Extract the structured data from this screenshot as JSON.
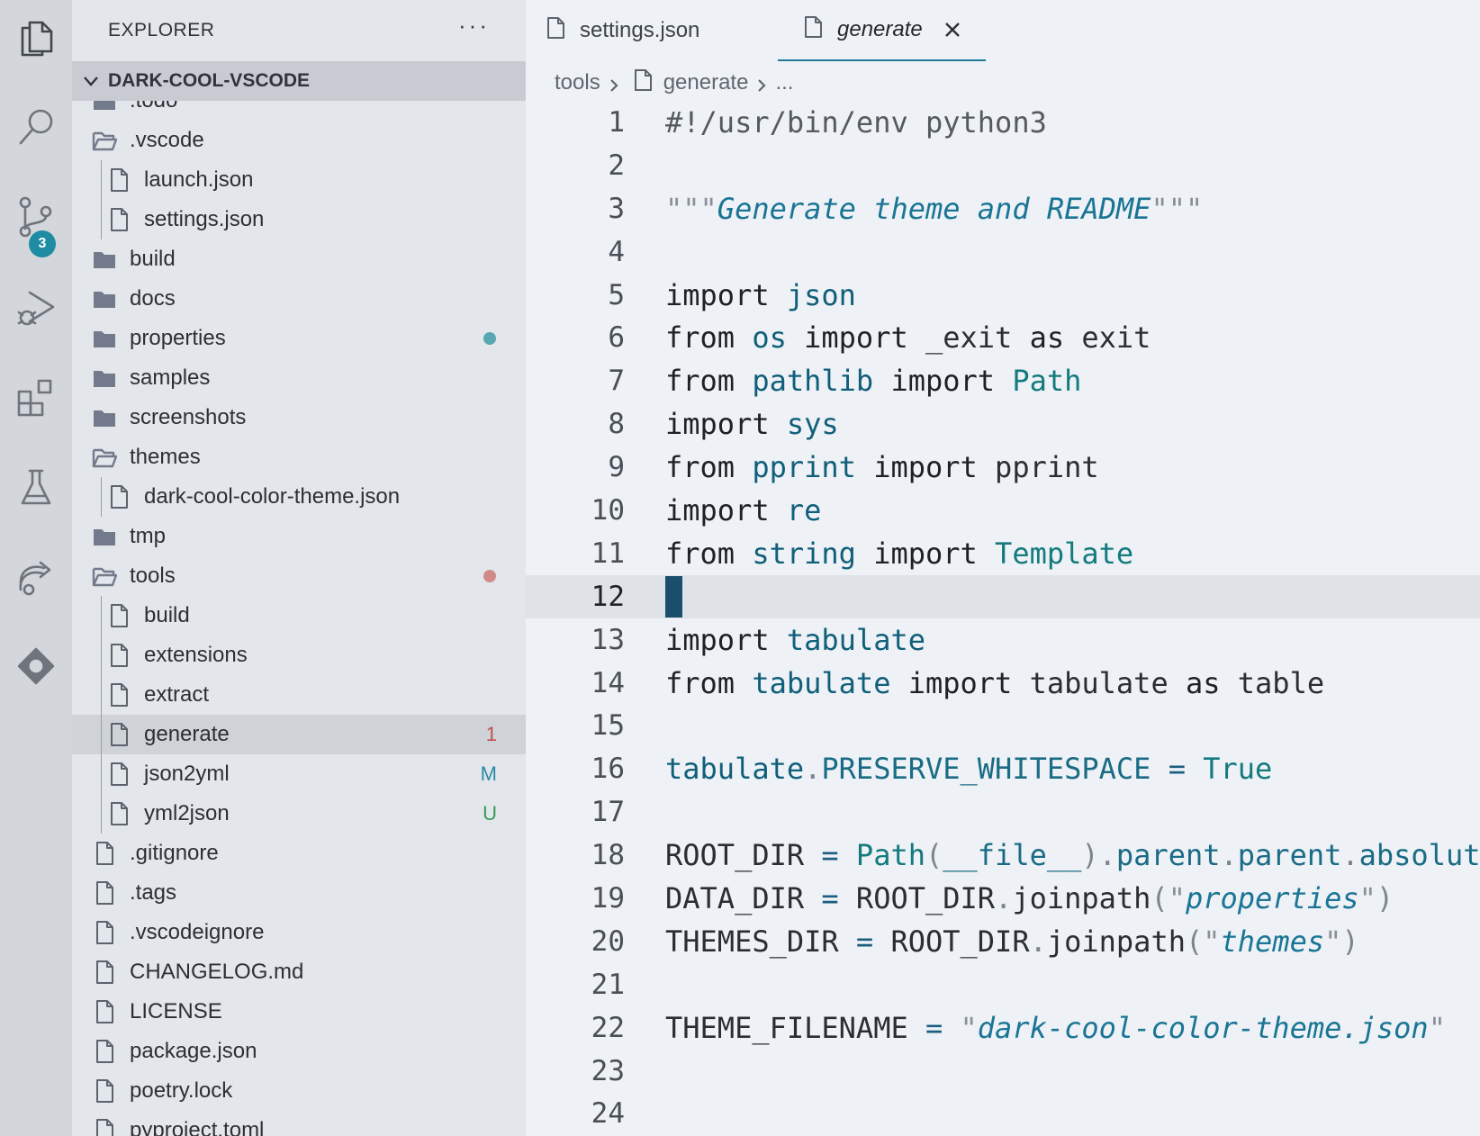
{
  "activity_bar": {
    "items": [
      "files-icon",
      "search-icon",
      "source-control-icon",
      "run-debug-icon",
      "extensions-icon",
      "testing-icon",
      "remote-icon",
      "gitlens-icon"
    ],
    "scm_badge": "3"
  },
  "explorer": {
    "title": "EXPLORER",
    "more": "···",
    "project": "DARK-COOL-VSCODE",
    "tree": [
      {
        "label": ".todo",
        "type": "folder",
        "depth": 0
      },
      {
        "label": ".vscode",
        "type": "folder-open",
        "depth": 0
      },
      {
        "label": "launch.json",
        "type": "file",
        "depth": 1
      },
      {
        "label": "settings.json",
        "type": "file",
        "depth": 1
      },
      {
        "label": "build",
        "type": "folder",
        "depth": 0
      },
      {
        "label": "docs",
        "type": "folder",
        "depth": 0
      },
      {
        "label": "properties",
        "type": "folder",
        "depth": 0,
        "dot": "#5aa7b3"
      },
      {
        "label": "samples",
        "type": "folder",
        "depth": 0
      },
      {
        "label": "screenshots",
        "type": "folder",
        "depth": 0
      },
      {
        "label": "themes",
        "type": "folder-open",
        "depth": 0
      },
      {
        "label": "dark-cool-color-theme.json",
        "type": "file",
        "depth": 1
      },
      {
        "label": "tmp",
        "type": "folder",
        "depth": 0
      },
      {
        "label": "tools",
        "type": "folder-open",
        "depth": 0,
        "dot": "#d08a8a"
      },
      {
        "label": "build",
        "type": "file",
        "depth": 1
      },
      {
        "label": "extensions",
        "type": "file",
        "depth": 1
      },
      {
        "label": "extract",
        "type": "file",
        "depth": 1
      },
      {
        "label": "generate",
        "type": "file",
        "depth": 1,
        "badge": "1",
        "badge_color": "#c0504d",
        "selected": true
      },
      {
        "label": "json2yml",
        "type": "file",
        "depth": 1,
        "badge": "M",
        "badge_color": "#2a8aa8"
      },
      {
        "label": "yml2json",
        "type": "file",
        "depth": 1,
        "badge": "U",
        "badge_color": "#3a9a5b"
      },
      {
        "label": ".gitignore",
        "type": "file",
        "depth": 0
      },
      {
        "label": ".tags",
        "type": "file",
        "depth": 0
      },
      {
        "label": ".vscodeignore",
        "type": "file",
        "depth": 0
      },
      {
        "label": "CHANGELOG.md",
        "type": "file",
        "depth": 0
      },
      {
        "label": "LICENSE",
        "type": "file",
        "depth": 0
      },
      {
        "label": "package.json",
        "type": "file",
        "depth": 0
      },
      {
        "label": "poetry.lock",
        "type": "file",
        "depth": 0
      },
      {
        "label": "pyproject.toml",
        "type": "file",
        "depth": 0
      }
    ]
  },
  "tabs": [
    {
      "label": "settings.json",
      "active": false
    },
    {
      "label": "generate",
      "active": true
    }
  ],
  "breadcrumb": {
    "folder": "tools",
    "file": "generate",
    "more": "..."
  },
  "editor": {
    "current_line": 12,
    "lines": [
      [
        [
          "comment",
          "#!/usr/bin/env python3"
        ]
      ],
      [],
      [
        [
          "q",
          "\"\"\""
        ],
        [
          "str",
          "Generate theme and README"
        ],
        [
          "q",
          "\"\"\""
        ]
      ],
      [],
      [
        [
          "kw",
          "import"
        ],
        [
          "txt",
          " "
        ],
        [
          "mod",
          "json"
        ]
      ],
      [
        [
          "kw",
          "from"
        ],
        [
          "txt",
          " "
        ],
        [
          "mod",
          "os"
        ],
        [
          "txt",
          " "
        ],
        [
          "kw",
          "import"
        ],
        [
          "txt",
          " _exit "
        ],
        [
          "kw",
          "as"
        ],
        [
          "txt",
          " exit"
        ]
      ],
      [
        [
          "kw",
          "from"
        ],
        [
          "txt",
          " "
        ],
        [
          "mod",
          "pathlib"
        ],
        [
          "txt",
          " "
        ],
        [
          "kw",
          "import"
        ],
        [
          "txt",
          " "
        ],
        [
          "cls",
          "Path"
        ]
      ],
      [
        [
          "kw",
          "import"
        ],
        [
          "txt",
          " "
        ],
        [
          "mod",
          "sys"
        ]
      ],
      [
        [
          "kw",
          "from"
        ],
        [
          "txt",
          " "
        ],
        [
          "mod",
          "pprint"
        ],
        [
          "txt",
          " "
        ],
        [
          "kw",
          "import"
        ],
        [
          "txt",
          " pprint"
        ]
      ],
      [
        [
          "kw",
          "import"
        ],
        [
          "txt",
          " "
        ],
        [
          "mod",
          "re"
        ]
      ],
      [
        [
          "kw",
          "from"
        ],
        [
          "txt",
          " "
        ],
        [
          "mod",
          "string"
        ],
        [
          "txt",
          " "
        ],
        [
          "kw",
          "import"
        ],
        [
          "txt",
          " "
        ],
        [
          "cls",
          "Template"
        ]
      ],
      [],
      [
        [
          "kw",
          "import"
        ],
        [
          "txt",
          " "
        ],
        [
          "mod",
          "tabulate"
        ]
      ],
      [
        [
          "kw",
          "from"
        ],
        [
          "txt",
          " "
        ],
        [
          "mod",
          "tabulate"
        ],
        [
          "txt",
          " "
        ],
        [
          "kw",
          "import"
        ],
        [
          "txt",
          " tabulate "
        ],
        [
          "kw",
          "as"
        ],
        [
          "txt",
          " table"
        ]
      ],
      [],
      [
        [
          "mod",
          "tabulate"
        ],
        [
          "pun",
          "."
        ],
        [
          "attr",
          "PRESERVE_WHITESPACE"
        ],
        [
          "txt",
          " "
        ],
        [
          "op",
          "="
        ],
        [
          "txt",
          " "
        ],
        [
          "cls",
          "True"
        ]
      ],
      [],
      [
        [
          "txt",
          "ROOT_DIR "
        ],
        [
          "op",
          "="
        ],
        [
          "txt",
          " "
        ],
        [
          "cls",
          "Path"
        ],
        [
          "pun",
          "("
        ],
        [
          "attr",
          "__file__"
        ],
        [
          "pun",
          ")"
        ],
        [
          "pun",
          "."
        ],
        [
          "attr",
          "parent"
        ],
        [
          "pun",
          "."
        ],
        [
          "attr",
          "parent"
        ],
        [
          "pun",
          "."
        ],
        [
          "attr",
          "absolute"
        ],
        [
          "pun",
          "()"
        ]
      ],
      [
        [
          "txt",
          "DATA_DIR "
        ],
        [
          "op",
          "="
        ],
        [
          "txt",
          " ROOT_DIR"
        ],
        [
          "pun",
          "."
        ],
        [
          "txt",
          "joinpath"
        ],
        [
          "pun",
          "("
        ],
        [
          "q",
          "\""
        ],
        [
          "str",
          "properties"
        ],
        [
          "q",
          "\""
        ],
        [
          "pun",
          ")"
        ]
      ],
      [
        [
          "txt",
          "THEMES_DIR "
        ],
        [
          "op",
          "="
        ],
        [
          "txt",
          " ROOT_DIR"
        ],
        [
          "pun",
          "."
        ],
        [
          "txt",
          "joinpath"
        ],
        [
          "pun",
          "("
        ],
        [
          "q",
          "\""
        ],
        [
          "str",
          "themes"
        ],
        [
          "q",
          "\""
        ],
        [
          "pun",
          ")"
        ]
      ],
      [],
      [
        [
          "txt",
          "THEME_FILENAME "
        ],
        [
          "op",
          "="
        ],
        [
          "txt",
          " "
        ],
        [
          "q",
          "\""
        ],
        [
          "str",
          "dark-cool-color-theme.json"
        ],
        [
          "q",
          "\""
        ]
      ],
      [],
      []
    ]
  }
}
